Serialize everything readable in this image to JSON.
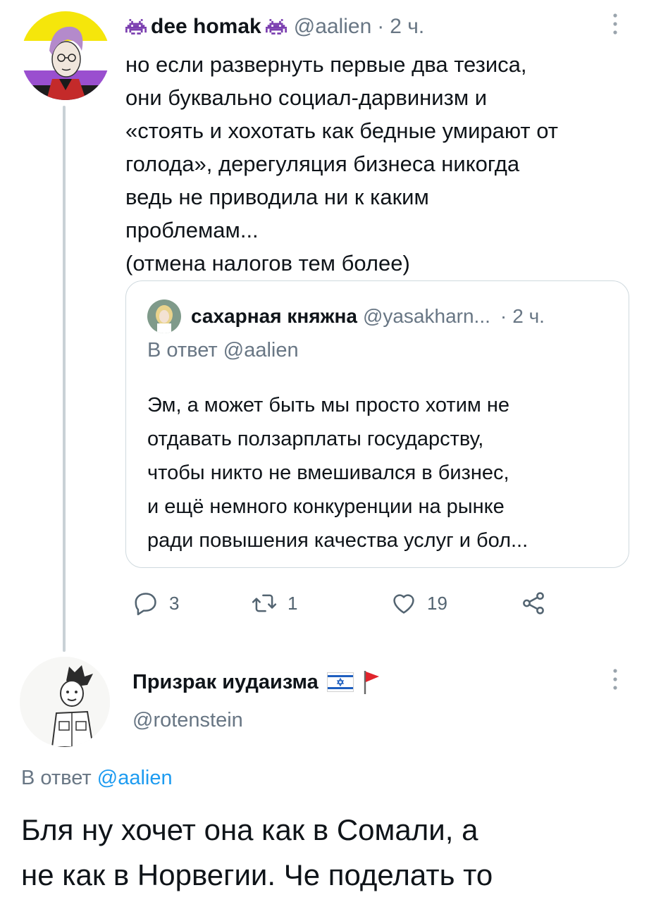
{
  "tweet": {
    "author_name": "dee homak",
    "author_handle": "@aalien",
    "time": "2 ч.",
    "separator": "·",
    "body": "но если развернуть первые два тезиса,\nони буквально социал-дарвинизм и\n«стоять и хохотать как бедные умирают от\nголода», дерегуляция бизнеса никогда\nведь не приводила ни к каким\nпроблемам...\n(отмена налогов тем более)",
    "quote": {
      "author_name": "сахарная княжна",
      "author_handle": "@yasakharn...",
      "separator": "·",
      "time": "2 ч.",
      "reply_prefix": "В ответ",
      "reply_mention": "@aalien",
      "body": "Эм, а может быть мы просто хотим не\nотдавать ползарплаты государству,\nчтобы никто не вмешивался в бизнес,\nи ещё немного конкуренции на рынке\nради повышения качества услуг и бол..."
    },
    "actions": {
      "replies": "3",
      "retweets": "1",
      "likes": "19"
    }
  },
  "reply_tweet": {
    "author_name": "Призрак иудаизма",
    "author_handle": "@rotenstein",
    "reply_prefix": "В ответ",
    "reply_mention": "@aalien",
    "body": "Бля ну хочет она как в Сомали, а\nне как в Норвегии. Че поделать то"
  },
  "icons": {
    "author_badge": "alien-invader-icon",
    "reply": "reply-icon",
    "retweet": "retweet-icon",
    "like": "heart-icon",
    "share": "share-icon",
    "more": "more-vertical-icon",
    "flags": [
      "israel-flag-icon",
      "red-flag-icon"
    ]
  },
  "colors": {
    "text": "#0f1419",
    "muted": "#687684",
    "link": "#1d9bf0",
    "thread_line": "#c9d1d6",
    "border": "#cfd9de"
  }
}
